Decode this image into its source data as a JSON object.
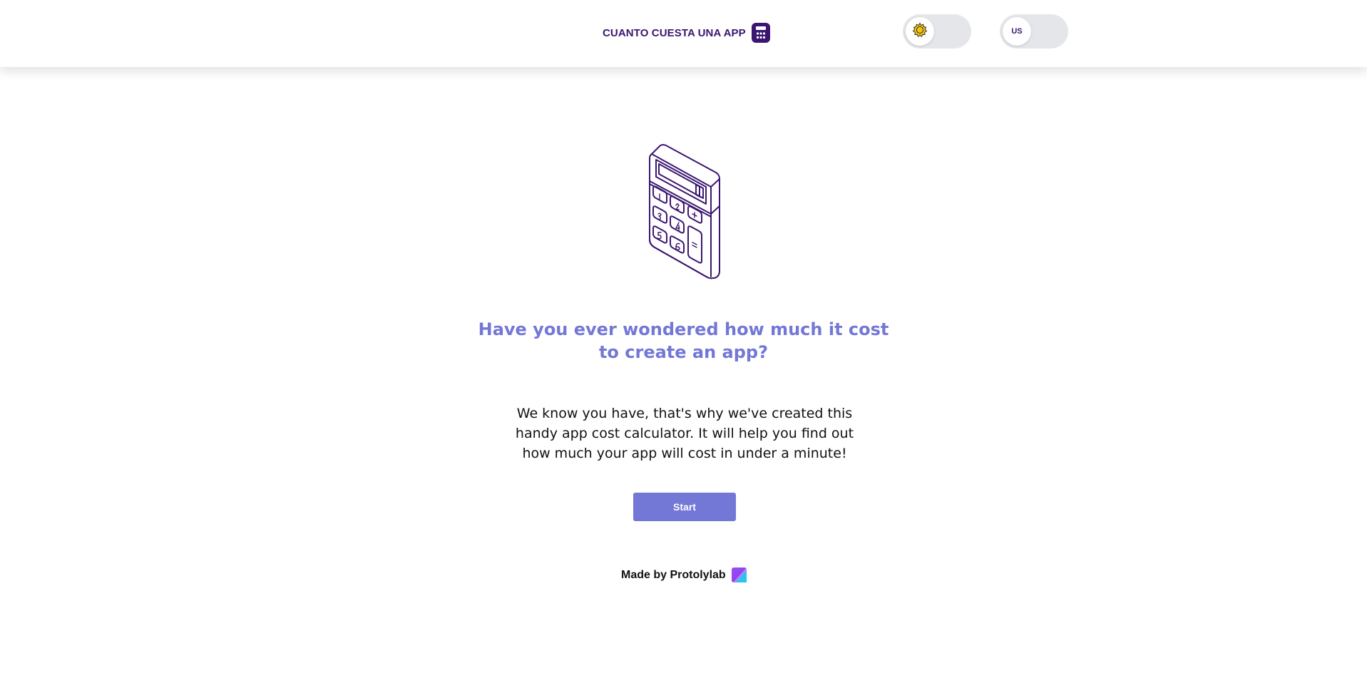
{
  "header": {
    "brand_text": "CUANTO CUESTA UNA APP",
    "brand_icon": "calculator-icon",
    "theme_toggle_icon": "sun-icon",
    "language_label": "US"
  },
  "hero": {
    "illustration": "calculator-illustration",
    "title_line1": "Have you ever wondered how much it cost",
    "title_line2": "to create an app?",
    "description_line1": "We know you have, that's why we've created this",
    "description_line2": "handy app cost calculator. It will help you find out",
    "description_line3": "how much your app will cost in under a minute!",
    "start_label": "Start"
  },
  "footer": {
    "made_by": "Made by Protolylab",
    "logo_icon": "protolylab-logo-icon"
  },
  "colors": {
    "brand_dark": "#3b1670",
    "accent": "#7377d6",
    "toggle_bg": "#e5e6ea",
    "sun": "#f2c318"
  }
}
